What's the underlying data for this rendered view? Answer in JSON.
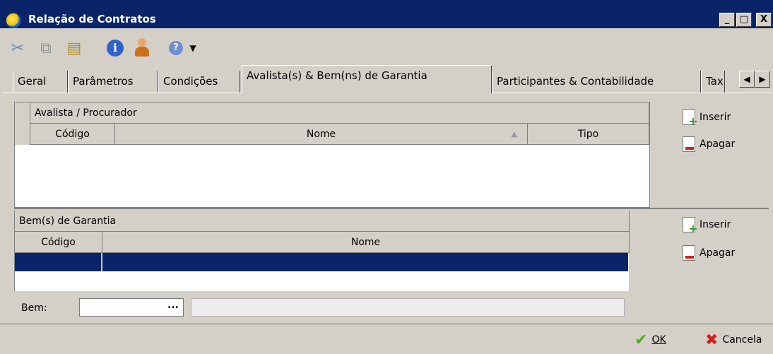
{
  "window": {
    "title": "Relação de Contratos",
    "controls": {
      "minimize": "_",
      "maximize": "□",
      "close": "X"
    }
  },
  "toolbar": {
    "icons": [
      "cut-icon",
      "copy-icon",
      "paste-icon",
      "info-icon",
      "user-icon",
      "help-icon",
      "dropdown-arrow-icon"
    ]
  },
  "tabs": [
    {
      "label": "Geral"
    },
    {
      "label": "Parâmetros"
    },
    {
      "label": "Condições"
    },
    {
      "label": "Avalista(s) & Bem(ns) de Garantia",
      "active": true
    },
    {
      "label": "Participantes & Contabilidade"
    },
    {
      "label": "Tax"
    }
  ],
  "avalista_grid": {
    "title": "Avalista / Procurador",
    "columns": [
      "Código",
      "Nome",
      "Tipo"
    ],
    "sort_indicator": "▲",
    "rows": []
  },
  "avalista_actions": {
    "insert": "Inserir",
    "delete": "Apagar"
  },
  "bens_grid": {
    "title": "Bem(s) de Garantia",
    "columns": [
      "Código",
      "Nome"
    ],
    "rows": [
      {
        "codigo": "",
        "nome": "",
        "selected": true
      }
    ]
  },
  "bens_actions": {
    "insert": "Inserir",
    "delete": "Apagar"
  },
  "bem_field": {
    "label": "Bem:",
    "value": "",
    "ellipsis": "...",
    "description": ""
  },
  "footer": {
    "ok": "OK",
    "cancel": "Cancela"
  },
  "colors": {
    "title_bar": "#0a246a",
    "selected_row": "#0a246a",
    "face": "#d4d0c8"
  }
}
